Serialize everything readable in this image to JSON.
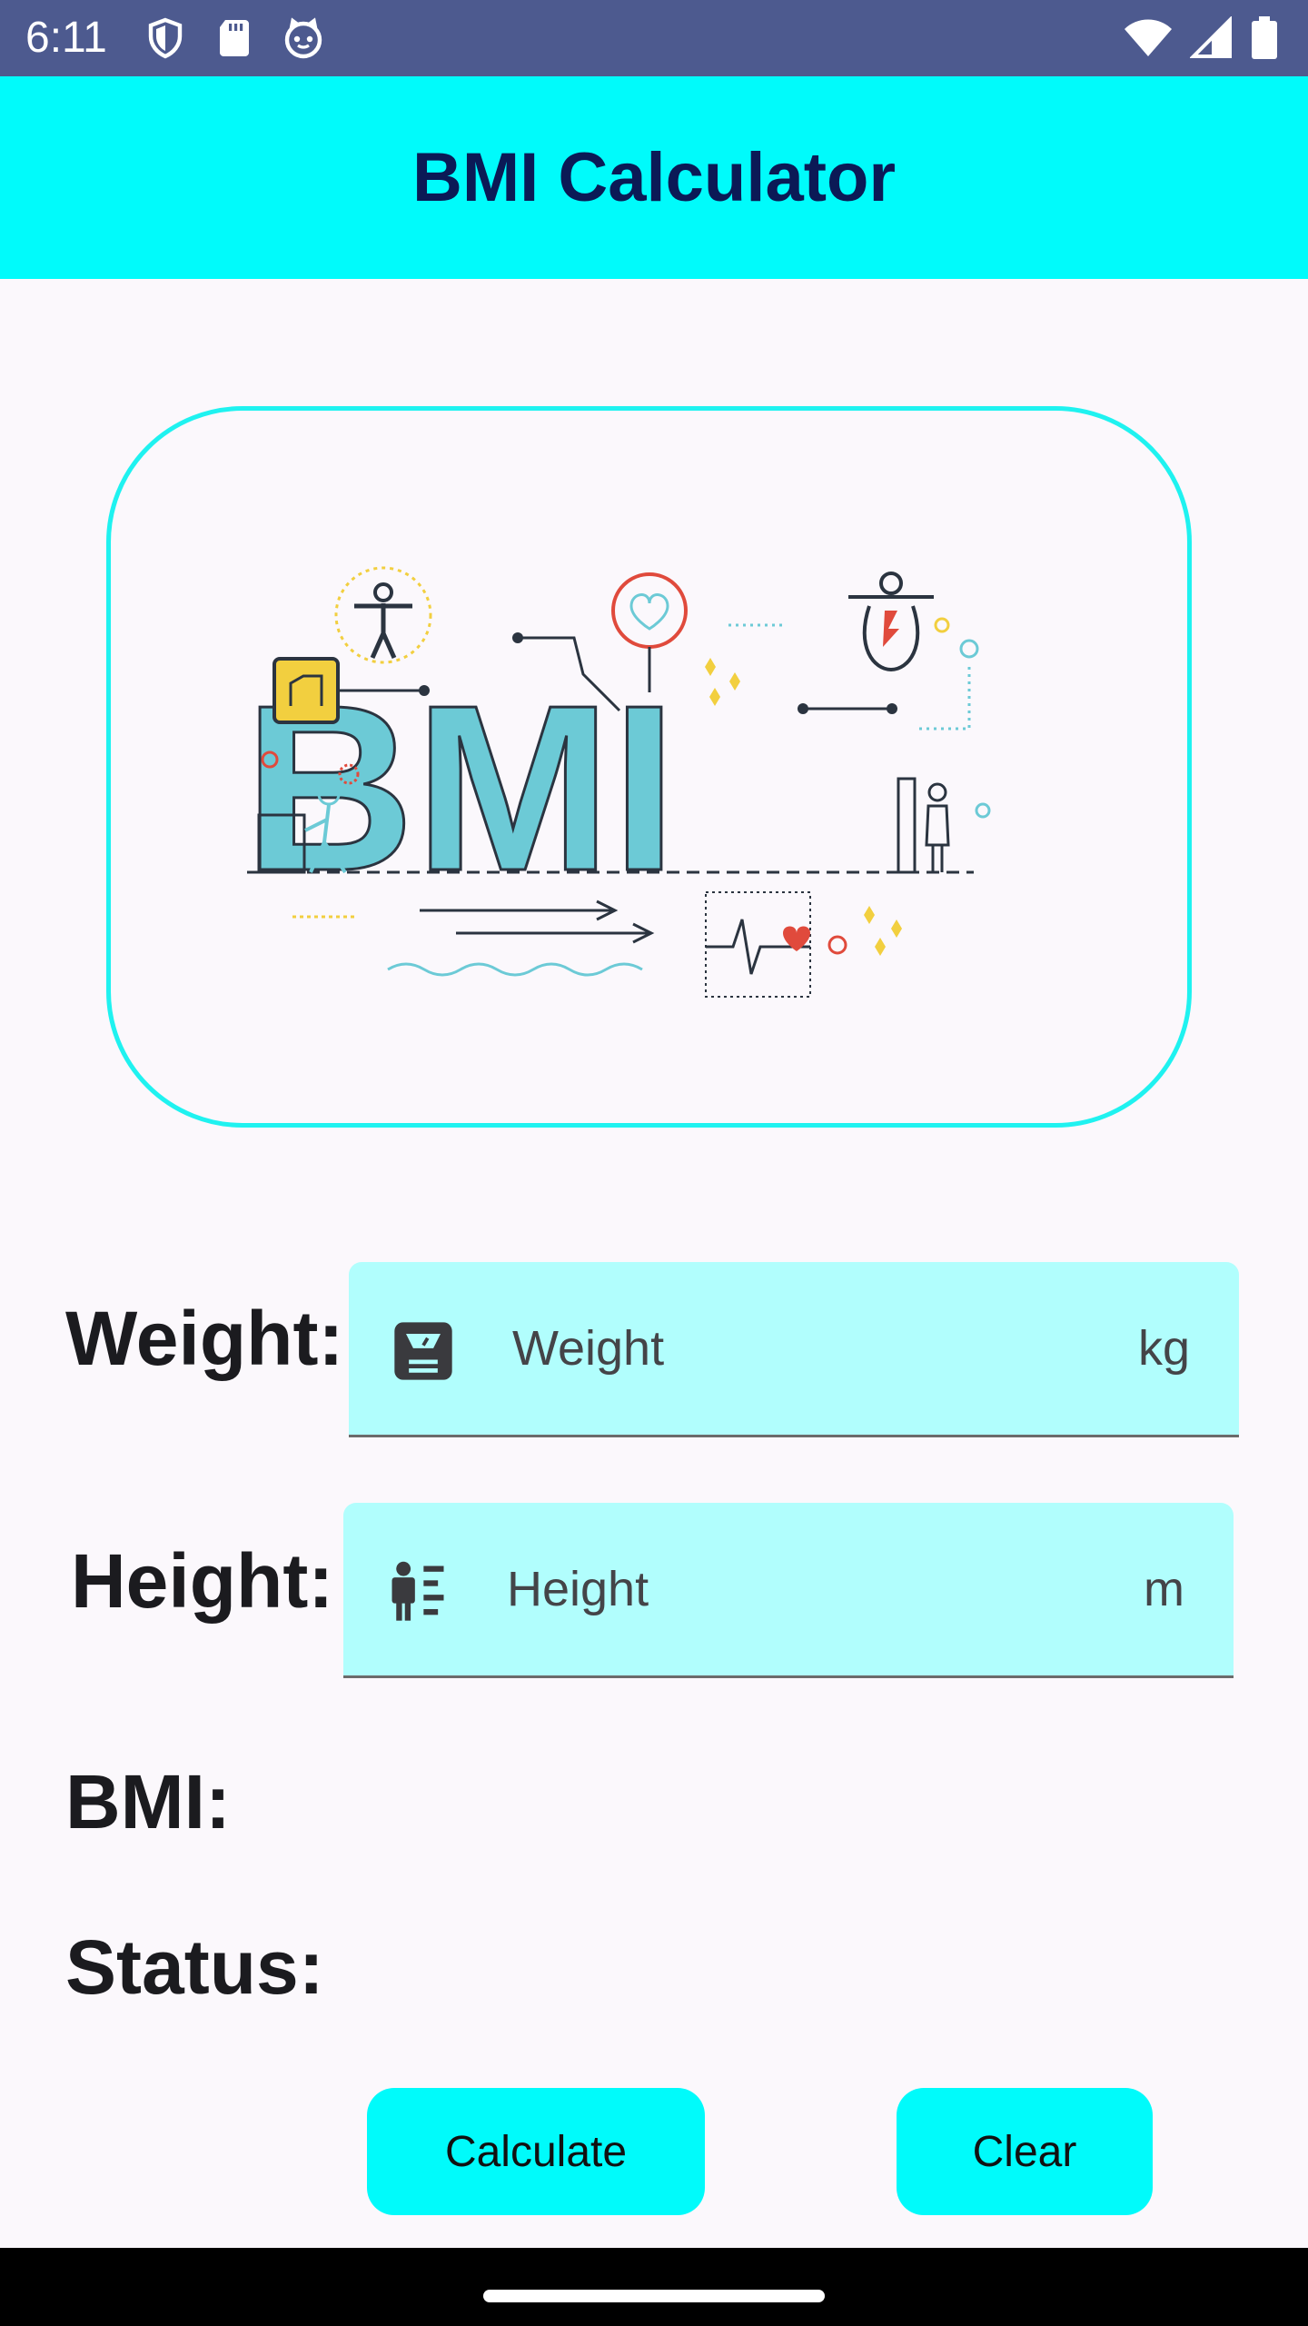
{
  "status_bar": {
    "time": "6:11",
    "left_icons": [
      "shield-icon",
      "sd-card-icon",
      "cat-icon"
    ],
    "right_icons": [
      "wifi-icon",
      "signal-icon",
      "battery-icon"
    ]
  },
  "app_bar": {
    "title": "BMI Calculator",
    "color": "#00fbfb"
  },
  "illustration": {
    "big_text": "BMI",
    "icons": [
      "bmi-illustration-icon"
    ]
  },
  "form": {
    "weight": {
      "label": "Weight:",
      "placeholder": "Weight",
      "suffix": "kg",
      "icon": "scale-icon"
    },
    "height": {
      "label": "Height:",
      "placeholder": "Height",
      "suffix": "m",
      "icon": "height-measure-icon"
    },
    "bmi_label": "BMI:",
    "status_label": "Status:"
  },
  "buttons": {
    "calculate": "Calculate",
    "clear": "Clear",
    "color": "#00fbfb"
  }
}
